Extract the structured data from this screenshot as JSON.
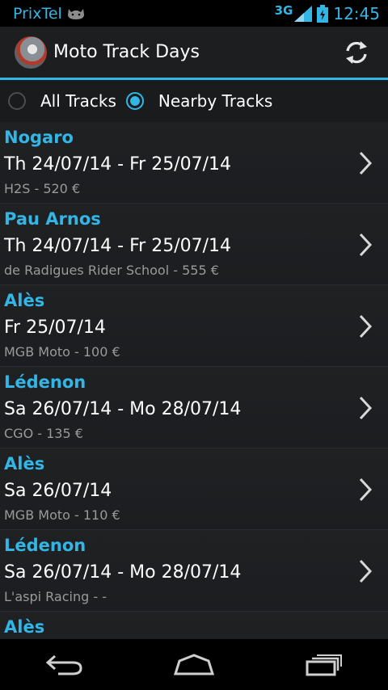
{
  "status_bar": {
    "carrier": "PrixTel",
    "network": "3G",
    "time": "12:45"
  },
  "action_bar": {
    "title": "Moto Track Days",
    "refresh_icon": "refresh-icon"
  },
  "filter": {
    "all_label": "All Tracks",
    "nearby_label": "Nearby Tracks",
    "selected": "nearby"
  },
  "colors": {
    "accent": "#33b5e5",
    "background": "#1b1c1e",
    "secondary_text": "#9a9a9a"
  },
  "items": [
    {
      "track": "Nogaro",
      "dates": "Th 24/07/14 - Fr 25/07/14",
      "organizer": "H2S - 520 €"
    },
    {
      "track": "Pau Arnos",
      "dates": "Th 24/07/14 - Fr 25/07/14",
      "organizer": "de Radigues Rider School - 555 €"
    },
    {
      "track": "Alès",
      "dates": "Fr 25/07/14",
      "organizer": "MGB Moto - 100 €"
    },
    {
      "track": "Lédenon",
      "dates": "Sa 26/07/14 - Mo 28/07/14",
      "organizer": "CGO - 135 €"
    },
    {
      "track": "Alès",
      "dates": "Sa 26/07/14",
      "organizer": "MGB Moto - 110 €"
    },
    {
      "track": "Lédenon",
      "dates": "Sa 26/07/14 - Mo 28/07/14",
      "organizer": "L'aspi Racing - -"
    },
    {
      "track": "Alès",
      "dates": "",
      "organizer": ""
    }
  ],
  "nav_bar": {
    "back": "back-icon",
    "home": "home-icon",
    "recents": "recents-icon"
  }
}
